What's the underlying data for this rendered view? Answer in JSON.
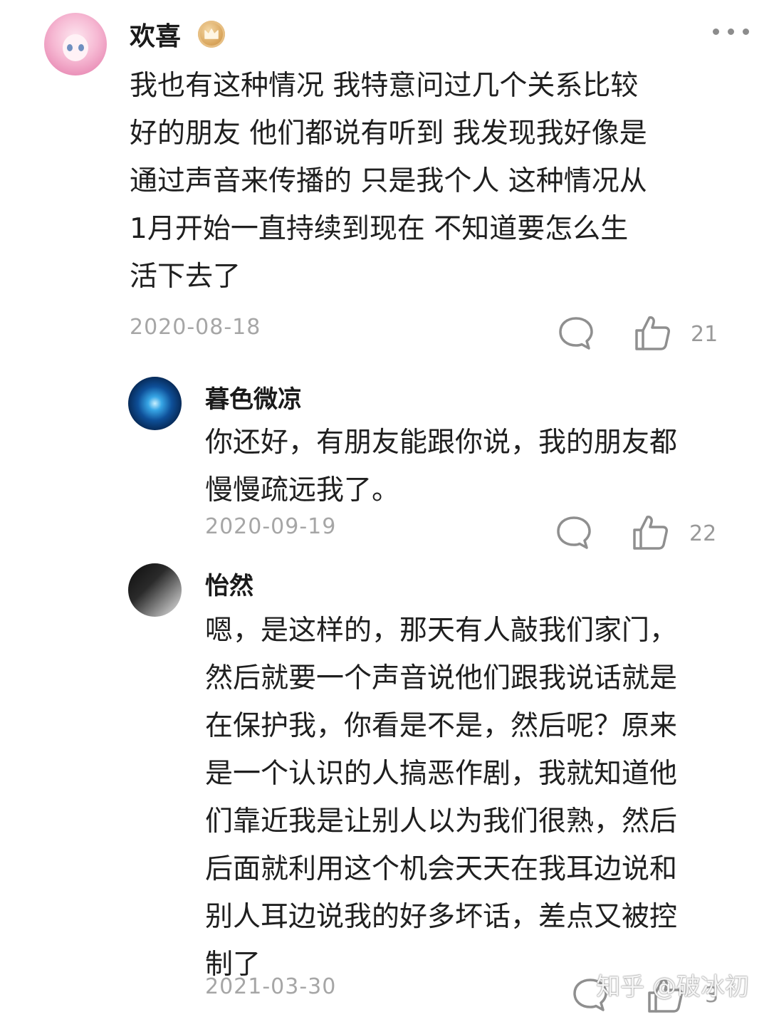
{
  "comments": [
    {
      "username": "欢喜",
      "lines": [
        "我也有这种情况 我特意问过几个关系比较",
        "好的朋友 他们都说有听到 我发现我好像是",
        "通过声音来传播的 只是我个人 这种情况从",
        "1月开始一直持续到现在 不知道要怎么生",
        "活下去了"
      ],
      "date": "2020-08-18",
      "likes": "21"
    },
    {
      "username": "暮色微凉",
      "lines": [
        "你还好，有朋友能跟你说，我的朋友都",
        "慢慢疏远我了。"
      ],
      "date": "2020-09-19",
      "likes": "22"
    },
    {
      "username": "怡然",
      "lines": [
        "嗯，是这样的，那天有人敲我们家门，",
        "然后就要一个声音说他们跟我说话就是",
        "在保护我，你看是不是，然后呢？原来",
        "是一个认识的人搞恶作剧，我就知道他",
        "们靠近我是让别人以为我们很熟，然后",
        "后面就利用这个机会天天在我耳边说和",
        "别人耳边说我的好多坏话，差点又被控",
        "制了"
      ],
      "date": "2021-03-30",
      "likes": "3"
    }
  ],
  "watermark": "知乎 @破冰初",
  "icons": {
    "comment": "speech-bubble-icon",
    "like": "thumbs-up-icon",
    "more": "more-dots-icon",
    "badge": "crown-badge-icon"
  },
  "colors": {
    "text": "#1f1f1f",
    "muted": "#a6a6a6",
    "badge": "#d9a55c"
  }
}
